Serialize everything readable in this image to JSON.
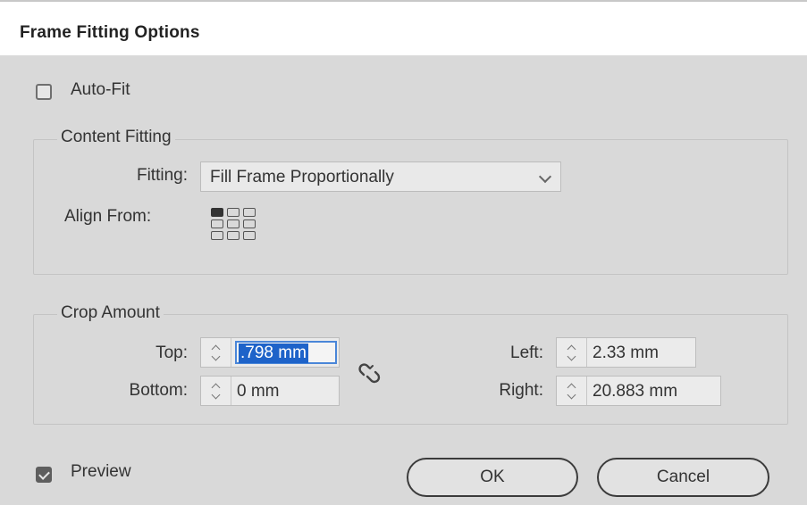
{
  "dialog": {
    "title": "Frame Fitting Options"
  },
  "auto_fit": {
    "label": "Auto-Fit",
    "checked": false
  },
  "content_fitting": {
    "group_label": "Content Fitting",
    "fitting_label": "Fitting:",
    "fitting_value": "Fill Frame Proportionally",
    "align_from_label": "Align From:",
    "align_from_selected": "top-left"
  },
  "crop_amount": {
    "group_label": "Crop Amount",
    "top_label": "Top:",
    "top_value": ".798 mm",
    "bottom_label": "Bottom:",
    "bottom_value": "0 mm",
    "left_label": "Left:",
    "left_value": "2.33 mm",
    "right_label": "Right:",
    "right_value": "20.883 mm",
    "link_icon": "chain-link-broken-icon"
  },
  "preview": {
    "label": "Preview",
    "checked": true
  },
  "buttons": {
    "ok": "OK",
    "cancel": "Cancel"
  },
  "colors": {
    "selection": "#1e63c9",
    "focus_ring": "#4a86d8"
  }
}
